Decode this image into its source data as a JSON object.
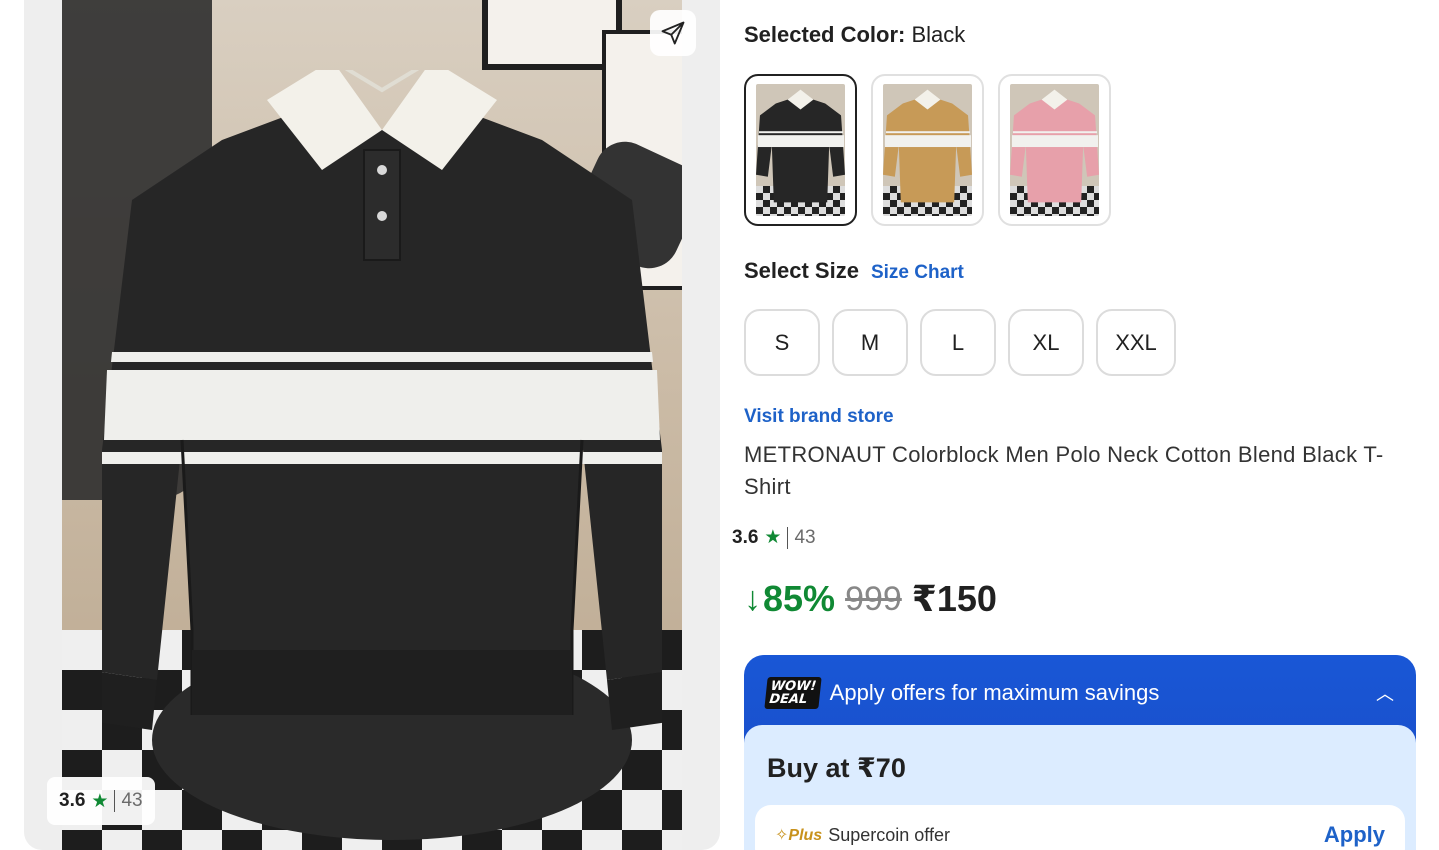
{
  "gallery": {
    "rating": "3.6",
    "rating_count": "43",
    "share_icon": "send-icon"
  },
  "color_selector": {
    "label": "Selected Color:",
    "value": "Black",
    "options": [
      {
        "name": "Black",
        "shirt_color": "#262626",
        "active": true
      },
      {
        "name": "Mustard",
        "shirt_color": "#c79a57",
        "active": false
      },
      {
        "name": "Pink",
        "shirt_color": "#e7a0aa",
        "active": false
      }
    ]
  },
  "size_selector": {
    "label": "Select Size",
    "chart_link": "Size Chart",
    "sizes": [
      "S",
      "M",
      "L",
      "XL",
      "XXL"
    ]
  },
  "brand_link": "Visit brand store",
  "product_title": "METRONAUT Colorblock Men Polo Neck Cotton Blend Black T-Shirt",
  "rating": {
    "value": "3.6",
    "count": "43"
  },
  "pricing": {
    "discount": "85%",
    "mrp": "999",
    "price": "₹150"
  },
  "offers": {
    "badge": "WOW! DEAL",
    "title": "Apply offers for maximum savings",
    "buy_at": "Buy at ₹70",
    "supercoin": {
      "plus_label": "Plus",
      "label": "Supercoin offer",
      "action": "Apply"
    }
  },
  "colors": {
    "discount_green": "#108934",
    "link_blue": "#1e62c8",
    "offer_blue": "#1957d6",
    "offer_body": "#dcecff"
  }
}
